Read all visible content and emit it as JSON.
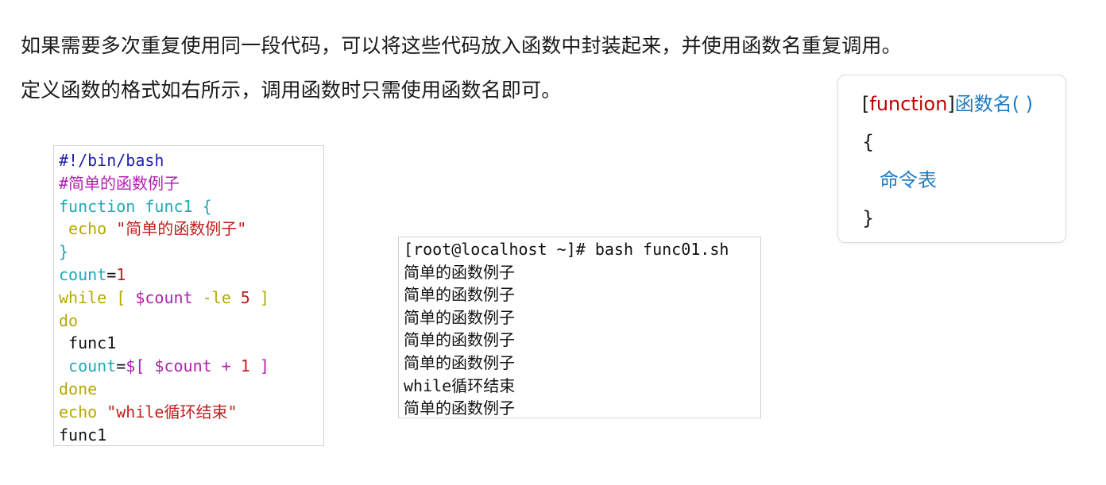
{
  "intro": {
    "line1": "如果需要多次重复使用同一段代码，可以将这些代码放入函数中封装起来，并使用函数名重复调用。",
    "line2": "定义函数的格式如右所示，调用函数时只需使用函数名即可。"
  },
  "syntax": {
    "open_bracket": "[",
    "keyword": "function",
    "close_bracket": "]",
    "name": "函数名( )",
    "brace_open": "{",
    "body": "命令表",
    "brace_close": "}"
  },
  "colors": {
    "comment": "#2020b0",
    "keyword": "#20a8b8",
    "control": "#b5a800",
    "string": "#c02020",
    "variable": "#b020b0",
    "plain": "#111111"
  },
  "script": {
    "lines": [
      [
        {
          "t": "#!/bin/bash",
          "c": "comment"
        }
      ],
      [
        {
          "t": "#简单的函数例子",
          "c": "variable"
        }
      ],
      [
        {
          "t": "function func1 {",
          "c": "keyword"
        }
      ],
      [
        {
          "t": " echo ",
          "c": "control"
        },
        {
          "t": "\"简单的函数例子\"",
          "c": "string"
        }
      ],
      [
        {
          "t": "}",
          "c": "keyword"
        }
      ],
      [
        {
          "t": "count",
          "c": "keyword"
        },
        {
          "t": "=",
          "c": "plain"
        },
        {
          "t": "1",
          "c": "string"
        }
      ],
      [
        {
          "t": "while [ ",
          "c": "control"
        },
        {
          "t": "$count",
          "c": "variable"
        },
        {
          "t": " -le ",
          "c": "control"
        },
        {
          "t": "5",
          "c": "string"
        },
        {
          "t": " ]",
          "c": "control"
        }
      ],
      [
        {
          "t": "do",
          "c": "control"
        }
      ],
      [
        {
          "t": " func1",
          "c": "plain"
        }
      ],
      [
        {
          "t": " count",
          "c": "keyword"
        },
        {
          "t": "=",
          "c": "plain"
        },
        {
          "t": "$[ ",
          "c": "variable"
        },
        {
          "t": "$count",
          "c": "variable"
        },
        {
          "t": " + ",
          "c": "variable"
        },
        {
          "t": "1",
          "c": "string"
        },
        {
          "t": " ]",
          "c": "variable"
        }
      ],
      [
        {
          "t": "done",
          "c": "control"
        }
      ],
      [
        {
          "t": "echo ",
          "c": "control"
        },
        {
          "t": "\"while循环结束\"",
          "c": "string"
        }
      ],
      [
        {
          "t": "func1",
          "c": "plain"
        }
      ]
    ]
  },
  "terminal": {
    "lines": [
      "[root@localhost ~]# bash func01.sh",
      "简单的函数例子",
      "简单的函数例子",
      "简单的函数例子",
      "简单的函数例子",
      "简单的函数例子",
      "while循环结束",
      "简单的函数例子"
    ]
  }
}
